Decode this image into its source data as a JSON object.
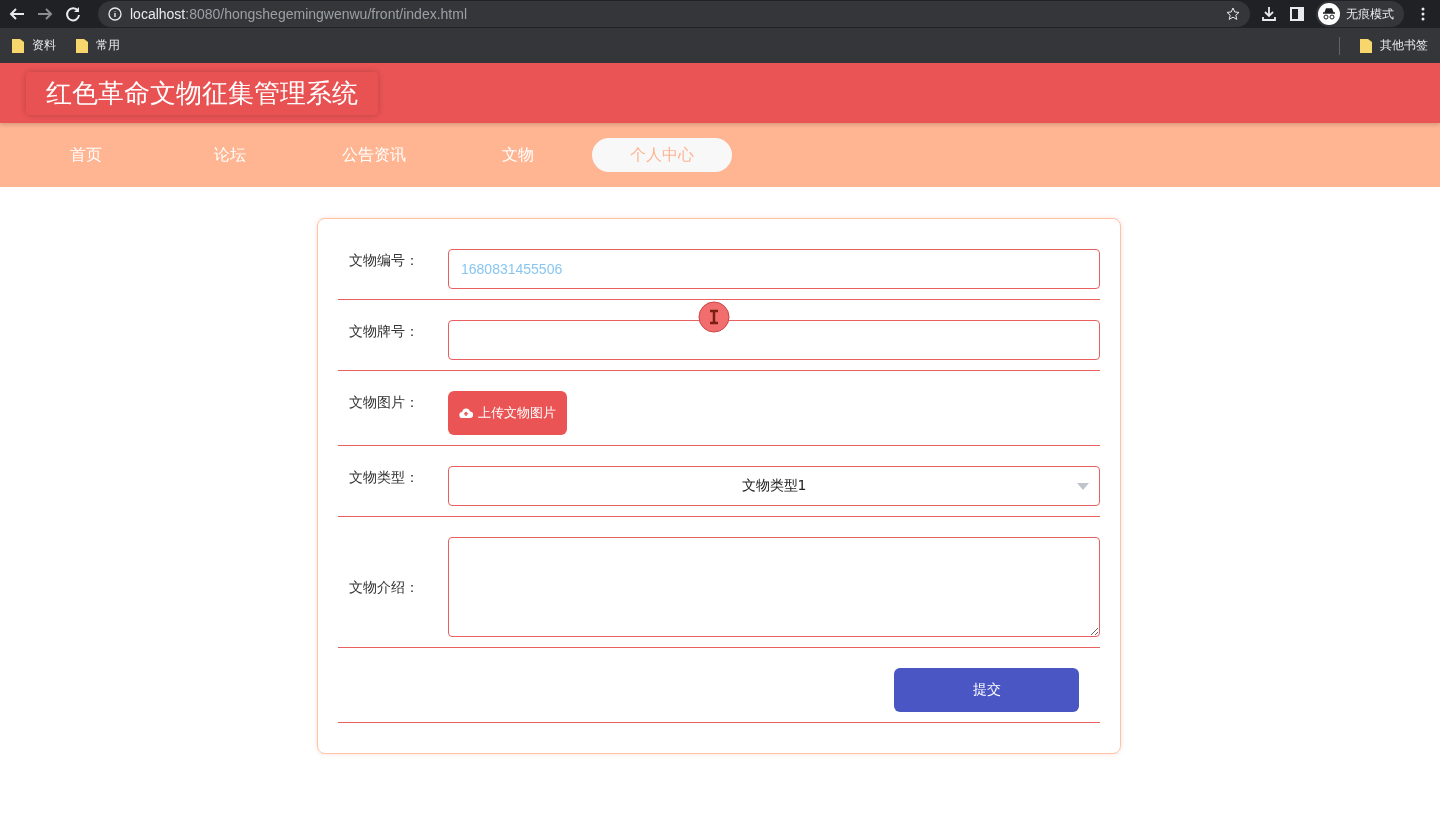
{
  "browser": {
    "url_host": "localhost",
    "url_path": ":8080/hongshegemingwenwu/front/index.html",
    "profile": "无痕模式",
    "bookmarks": [
      "资料",
      "常用"
    ],
    "other_bookmarks": "其他书签"
  },
  "header": {
    "title": "红色革命文物征集管理系统"
  },
  "nav": [
    {
      "label": "首页",
      "selected": false
    },
    {
      "label": "论坛",
      "selected": false
    },
    {
      "label": "公告资讯",
      "selected": false
    },
    {
      "label": "文物",
      "selected": false
    },
    {
      "label": "个人中心",
      "selected": true
    }
  ],
  "form": {
    "fields": [
      {
        "kind": "text",
        "label": "文物编号：",
        "value": "1680831455506"
      },
      {
        "kind": "text",
        "label": "文物牌号："
      },
      {
        "kind": "upload",
        "label": "文物图片：",
        "button": "上传文物图片"
      },
      {
        "kind": "select",
        "label": "文物类型：",
        "value": "文物类型1"
      },
      {
        "kind": "textarea",
        "label": "文物介绍："
      }
    ],
    "submit": "提交"
  }
}
